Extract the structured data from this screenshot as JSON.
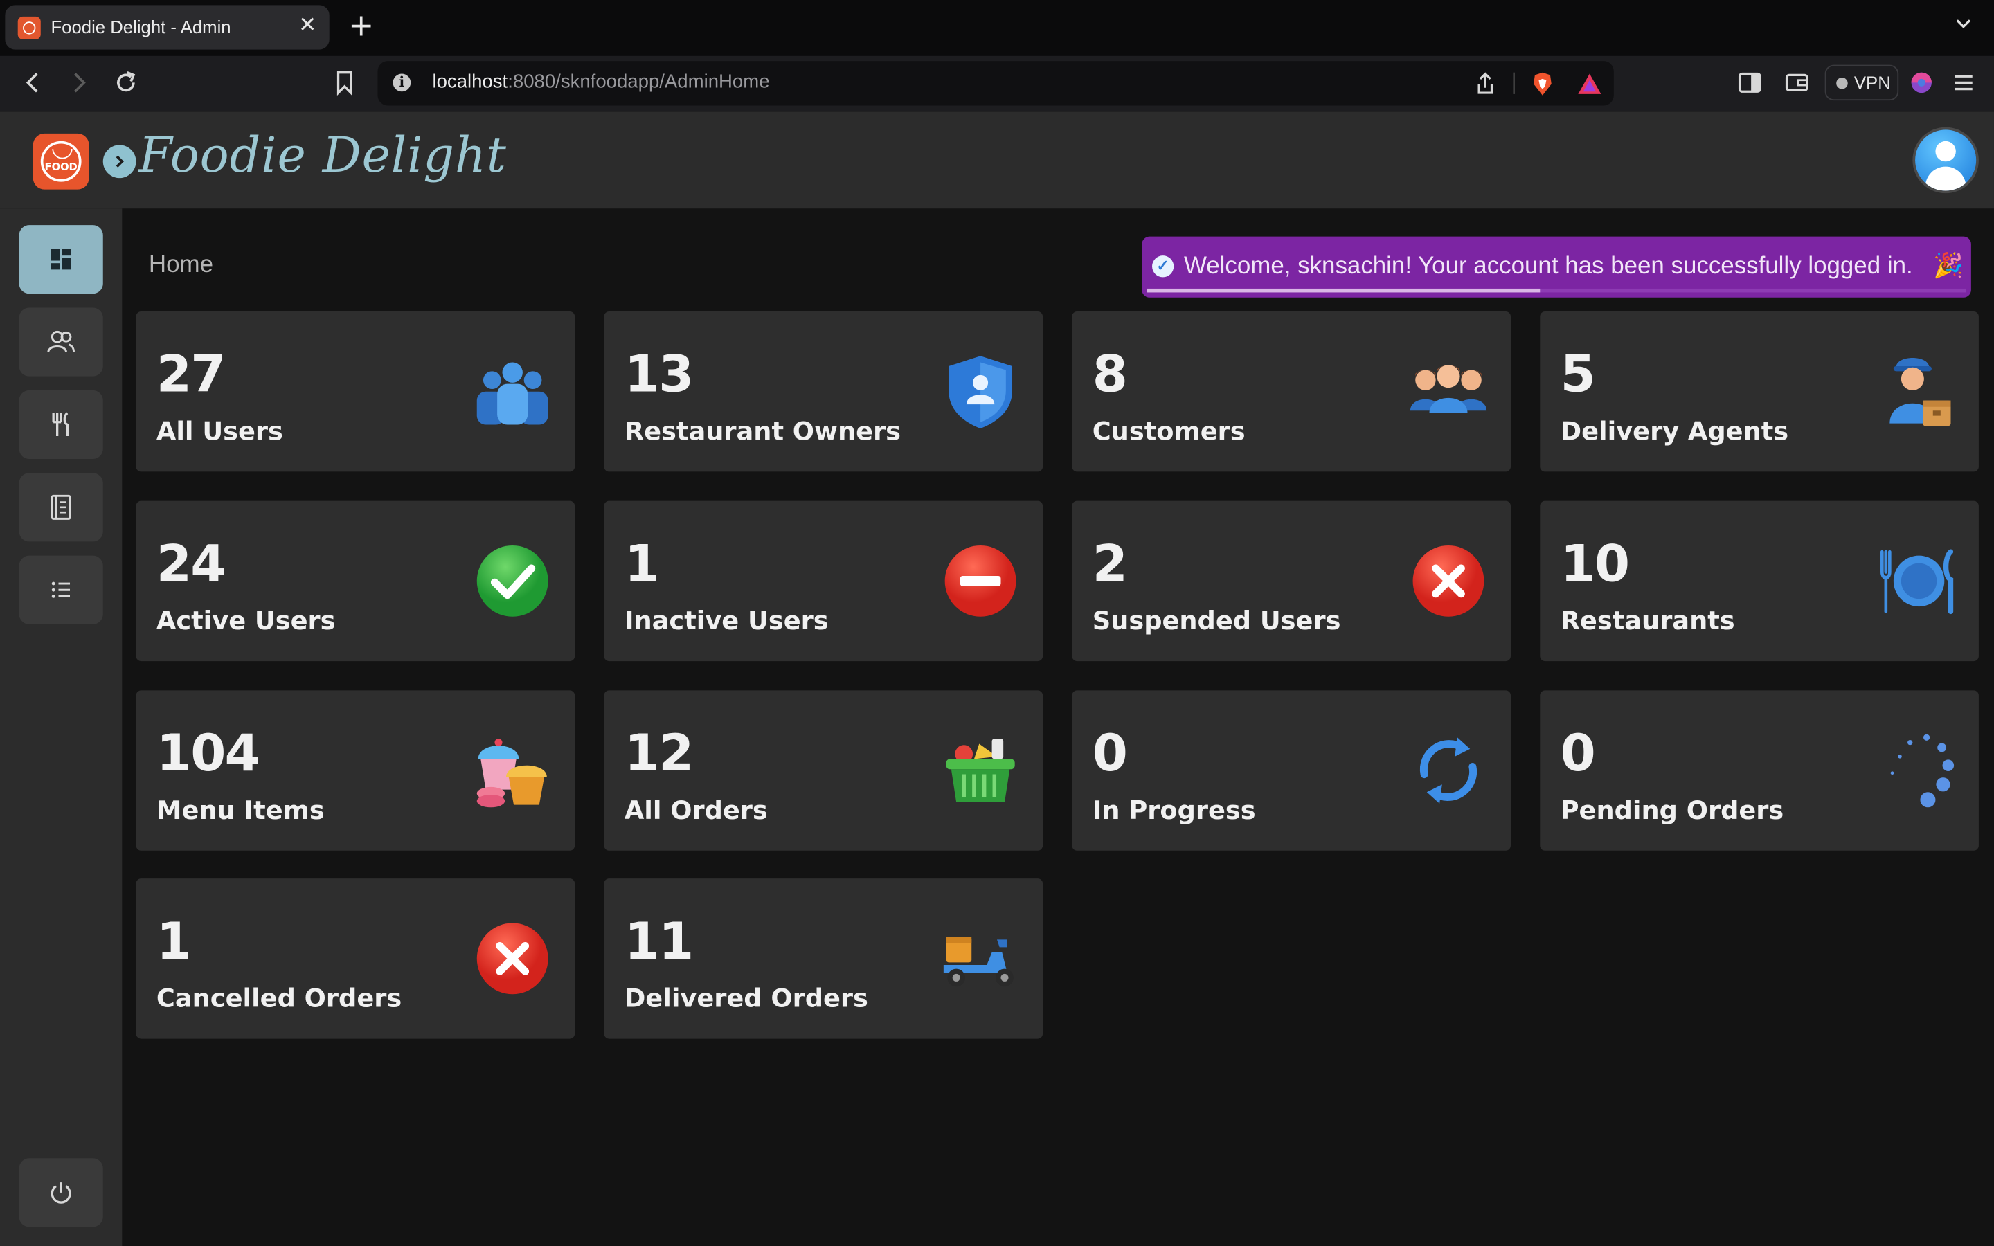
{
  "browser": {
    "tab_title": "Foodie Delight - Admin",
    "url_host": "localhost",
    "url_path": ":8080/sknfoodapp/AdminHome",
    "vpn_label": "VPN"
  },
  "header": {
    "logo_text": "FOOD",
    "brand_title": "Foodie Delight"
  },
  "sidebar": {
    "items": [
      {
        "icon": "dashboard-icon",
        "active": true
      },
      {
        "icon": "users-icon",
        "active": false
      },
      {
        "icon": "restaurant-icon",
        "active": false
      },
      {
        "icon": "menu-book-icon",
        "active": false
      },
      {
        "icon": "list-icon",
        "active": false
      }
    ],
    "logout_icon": "power-icon"
  },
  "main": {
    "breadcrumb": "Home",
    "toast": {
      "message": "Welcome, sknsachin! Your account has been successfully logged in.",
      "progress": 0.48,
      "color": "#7c25a3"
    },
    "cards": [
      {
        "value": "27",
        "label": "All Users",
        "icon": "people-group-icon"
      },
      {
        "value": "13",
        "label": "Restaurant Owners",
        "icon": "shield-user-icon"
      },
      {
        "value": "8",
        "label": "Customers",
        "icon": "customers-icon"
      },
      {
        "value": "5",
        "label": "Delivery Agents",
        "icon": "delivery-agent-icon"
      },
      {
        "value": "24",
        "label": "Active Users",
        "icon": "check-circle-icon"
      },
      {
        "value": "1",
        "label": "Inactive Users",
        "icon": "no-entry-icon"
      },
      {
        "value": "2",
        "label": "Suspended Users",
        "icon": "cross-circle-icon"
      },
      {
        "value": "10",
        "label": "Restaurants",
        "icon": "plate-fork-knife-icon"
      },
      {
        "value": "104",
        "label": "Menu Items",
        "icon": "cupcake-icon"
      },
      {
        "value": "12",
        "label": "All Orders",
        "icon": "basket-icon"
      },
      {
        "value": "0",
        "label": "In Progress",
        "icon": "refresh-cycle-icon"
      },
      {
        "value": "0",
        "label": "Pending Orders",
        "icon": "loading-dots-icon"
      },
      {
        "value": "1",
        "label": "Cancelled Orders",
        "icon": "cross-circle-icon"
      },
      {
        "value": "11",
        "label": "Delivered Orders",
        "icon": "delivery-scooter-icon"
      }
    ]
  }
}
